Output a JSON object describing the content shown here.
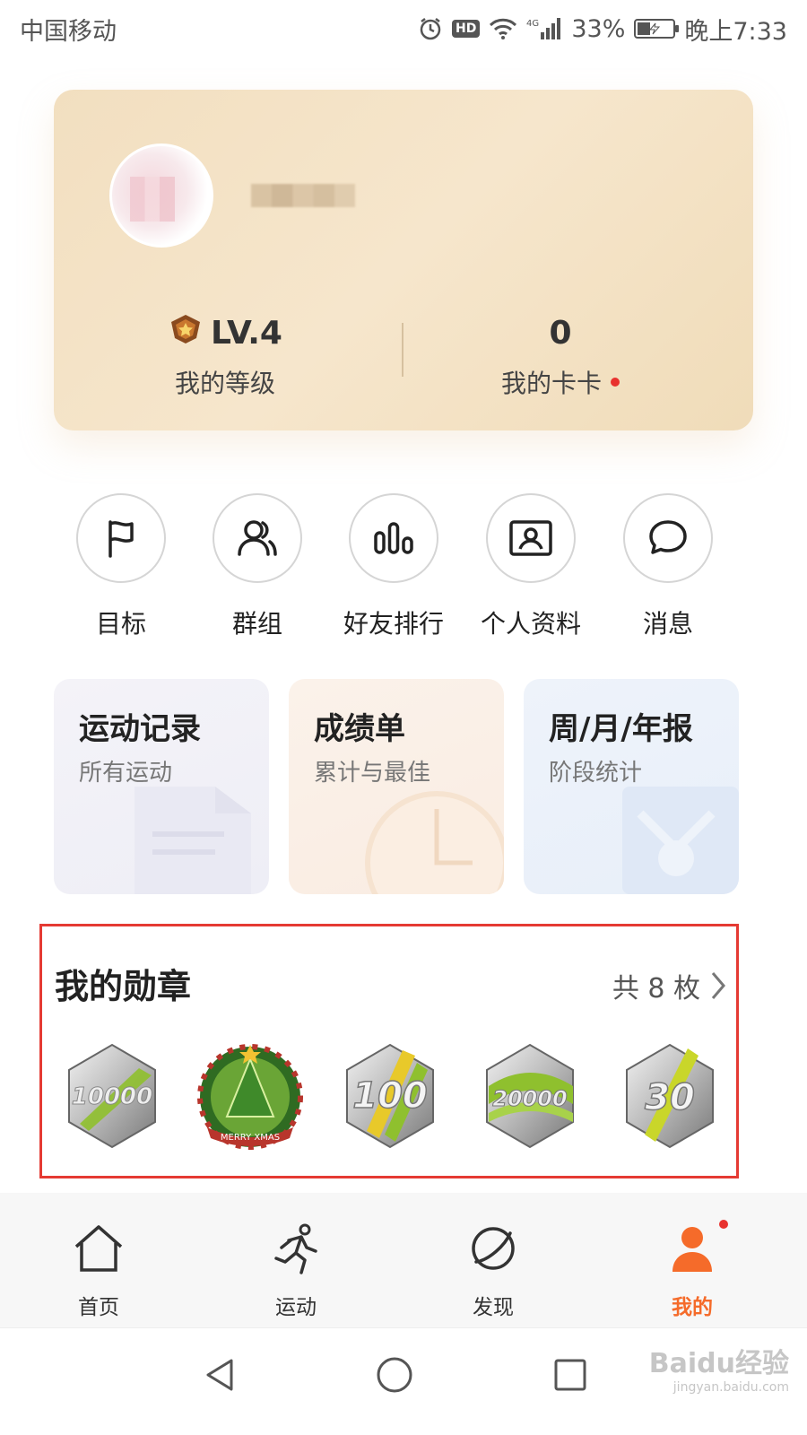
{
  "status_bar": {
    "carrier": "中国移动",
    "network": "4G",
    "battery": "33%",
    "battery_level": 0.33,
    "time": "晚上7:33"
  },
  "profile": {
    "level_value": "LV.4",
    "level_label": "我的等级",
    "cards_value": "0",
    "cards_label": "我的卡卡"
  },
  "quick_actions": [
    {
      "label": "目标",
      "icon": "flag-icon"
    },
    {
      "label": "群组",
      "icon": "group-icon"
    },
    {
      "label": "好友排行",
      "icon": "ranking-icon"
    },
    {
      "label": "个人资料",
      "icon": "profile-card-icon"
    },
    {
      "label": "消息",
      "icon": "message-icon"
    }
  ],
  "feature_cards": [
    {
      "title": "运动记录",
      "subtitle": "所有运动"
    },
    {
      "title": "成绩单",
      "subtitle": "累计与最佳"
    },
    {
      "title": "周/月/年报",
      "subtitle": "阶段统计"
    }
  ],
  "medals": {
    "title": "我的勋章",
    "count": "共 8 枚",
    "items": [
      {
        "label": "10000",
        "icon": "medal-10000-icon"
      },
      {
        "label": "MERRY XMAS",
        "icon": "medal-xmas-icon"
      },
      {
        "label": "100",
        "icon": "medal-100-icon"
      },
      {
        "label": "20000",
        "icon": "medal-20000-icon"
      },
      {
        "label": "30",
        "icon": "medal-30-icon"
      }
    ]
  },
  "bottom_nav": [
    {
      "label": "首页",
      "icon": "home-icon"
    },
    {
      "label": "运动",
      "icon": "running-icon"
    },
    {
      "label": "发现",
      "icon": "discover-icon"
    },
    {
      "label": "我的",
      "icon": "me-icon",
      "active": true
    }
  ],
  "watermark": {
    "brand": "Baidu经验",
    "url": "jingyan.baidu.com"
  },
  "colors": {
    "accent": "#f56b2a",
    "highlight_border": "#e53a33",
    "badge": "#e8322f"
  }
}
